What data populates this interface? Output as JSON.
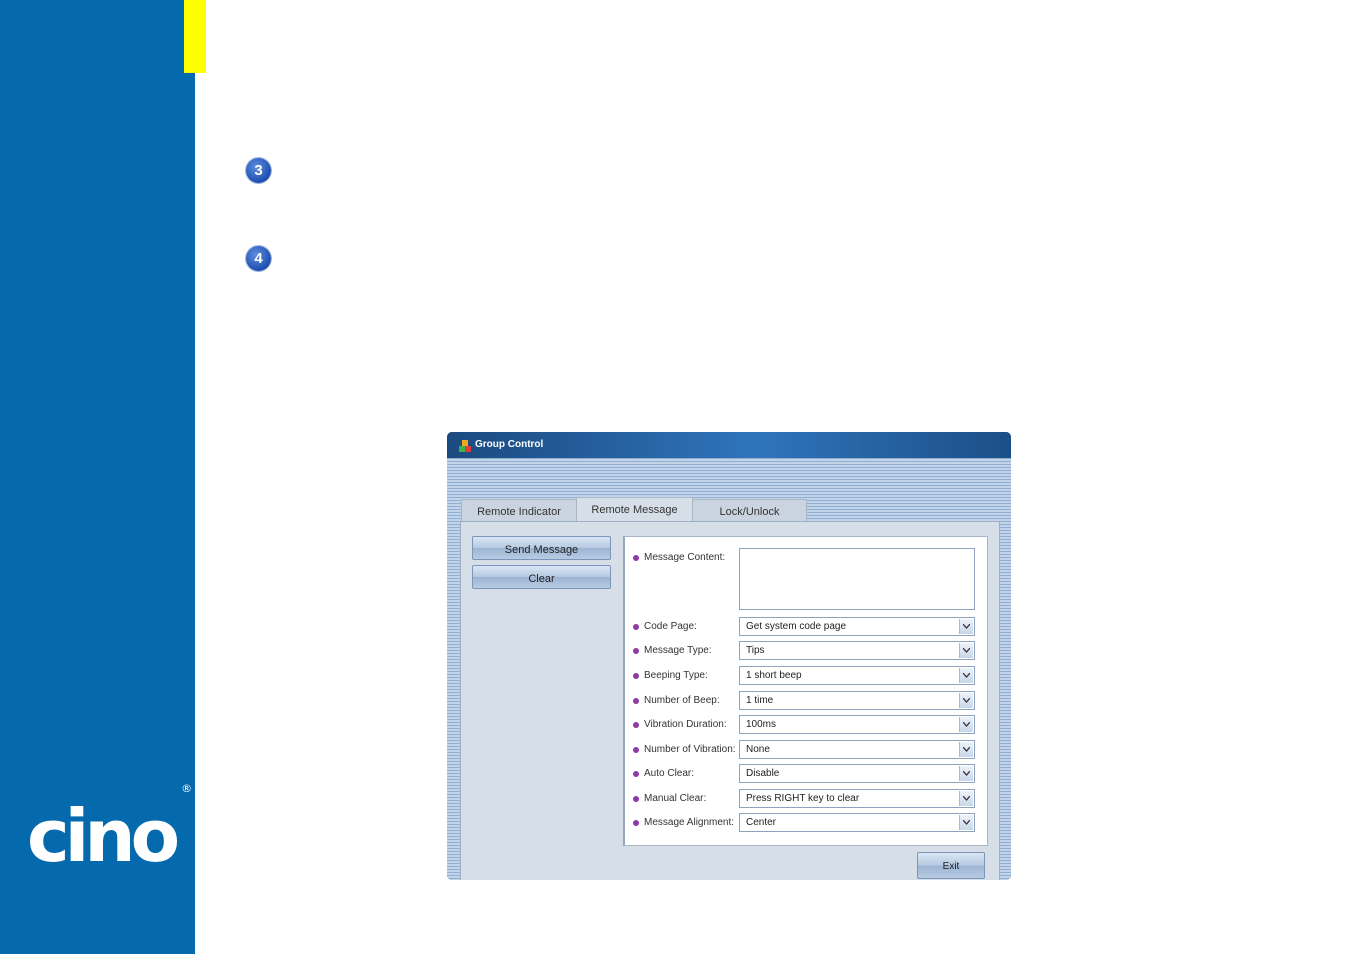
{
  "brand": {
    "logo_text": "cino",
    "registered_mark": "®"
  },
  "steps": [
    "3",
    "4"
  ],
  "window": {
    "title": "Group Control",
    "tabs": [
      "Remote Indicator",
      "Remote Message",
      "Lock/Unlock"
    ],
    "active_tab": "Remote Message",
    "buttons": {
      "send": "Send Message",
      "clear": "Clear",
      "exit": "Exit"
    },
    "form": {
      "message_content": {
        "label": "Message Content:",
        "value": ""
      },
      "fields": [
        {
          "label": "Code Page:",
          "value": "Get system code page"
        },
        {
          "label": "Message Type:",
          "value": "Tips"
        },
        {
          "label": "Beeping Type:",
          "value": "1 short beep"
        },
        {
          "label": "Number of Beep:",
          "value": "1 time"
        },
        {
          "label": "Vibration Duration:",
          "value": "100ms"
        },
        {
          "label": "Number of Vibration:",
          "value": "None"
        },
        {
          "label": "Auto Clear:",
          "value": "Disable"
        },
        {
          "label": "Manual Clear:",
          "value": "Press RIGHT key to clear"
        },
        {
          "label": "Message Alignment:",
          "value": "Center"
        }
      ]
    }
  },
  "colors": {
    "sidebar": "#0469ad",
    "accent": "#ffff00",
    "bullet": "#8d3aa8"
  }
}
